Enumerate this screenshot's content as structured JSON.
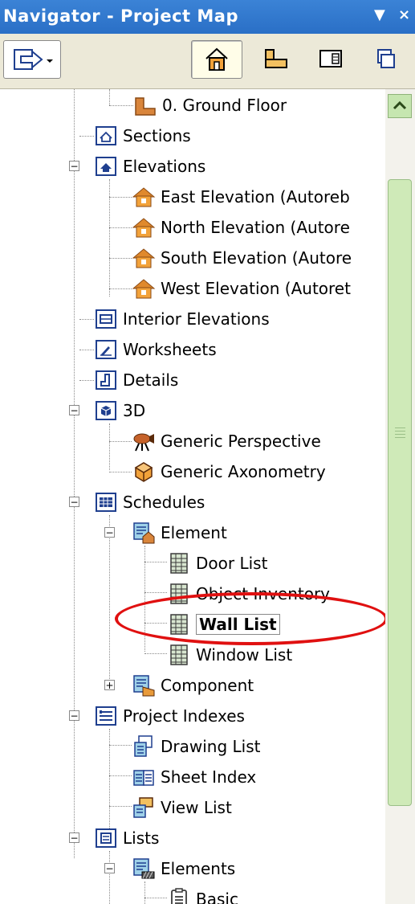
{
  "window": {
    "title": "Navigator - Project Map",
    "menu_glyph": "▼",
    "close_glyph": "×"
  },
  "toolbar": {
    "buttons": [
      {
        "icon": "publish-menu-icon"
      },
      {
        "icon": "project-map-icon",
        "pressed": true
      },
      {
        "icon": "view-map-icon"
      },
      {
        "icon": "layout-book-icon"
      },
      {
        "icon": "publisher-sets-icon"
      }
    ]
  },
  "tree": {
    "items": [
      {
        "label": "0. Ground Floor",
        "icon": "story-icon"
      },
      {
        "label": "Sections",
        "icon": "section-icon"
      },
      {
        "label": "Elevations",
        "icon": "elevation-folder-icon",
        "expanded": true
      },
      {
        "label": "East Elevation (Autoreb",
        "icon": "elevation-house-icon"
      },
      {
        "label": "North Elevation (Autore",
        "icon": "elevation-house-icon"
      },
      {
        "label": "South Elevation (Autore",
        "icon": "elevation-house-icon"
      },
      {
        "label": "West Elevation (Autoret",
        "icon": "elevation-house-icon"
      },
      {
        "label": "Interior Elevations",
        "icon": "interior-elevation-icon"
      },
      {
        "label": "Worksheets",
        "icon": "worksheet-icon"
      },
      {
        "label": "Details",
        "icon": "detail-icon"
      },
      {
        "label": "3D",
        "icon": "3d-folder-icon",
        "expanded": true
      },
      {
        "label": "Generic Perspective",
        "icon": "camera-icon"
      },
      {
        "label": "Generic Axonometry",
        "icon": "axonometry-icon"
      },
      {
        "label": "Schedules",
        "icon": "schedule-folder-icon",
        "expanded": true
      },
      {
        "label": "Element",
        "icon": "element-schedule-icon",
        "expanded": true
      },
      {
        "label": "Door List",
        "icon": "list-grid-icon"
      },
      {
        "label": "Object Inventory",
        "icon": "list-grid-icon"
      },
      {
        "label": "Wall List",
        "icon": "list-grid-icon",
        "selected": true
      },
      {
        "label": "Window List",
        "icon": "list-grid-icon"
      },
      {
        "label": "Component",
        "icon": "component-schedule-icon",
        "expanded": false
      },
      {
        "label": "Project Indexes",
        "icon": "project-index-folder-icon",
        "expanded": true
      },
      {
        "label": "Drawing List",
        "icon": "drawing-list-icon"
      },
      {
        "label": "Sheet Index",
        "icon": "sheet-index-icon"
      },
      {
        "label": "View List",
        "icon": "view-list-icon"
      },
      {
        "label": "Lists",
        "icon": "lists-folder-icon",
        "expanded": true
      },
      {
        "label": "Elements",
        "icon": "elements-list-icon",
        "expanded": true
      },
      {
        "label": "Basic",
        "icon": "basic-list-icon"
      }
    ]
  },
  "colors": {
    "title_bar": "#2a6fc6",
    "toolbar_bg": "#ece9d8",
    "highlight_ring": "#e01010",
    "scroll_green": "#cfeab8"
  }
}
